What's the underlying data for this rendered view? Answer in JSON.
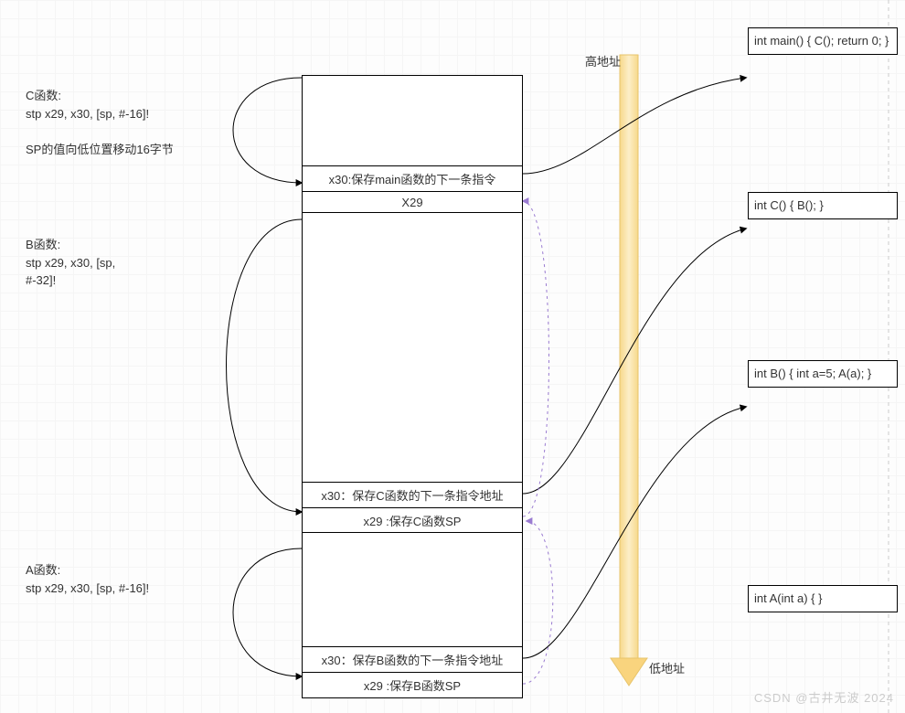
{
  "labels": {
    "highAddr": "高地址",
    "lowAddr": "低地址",
    "c": "C函数:\nstp x29, x30, [sp, #-16]!\n\nSP的值向低位置移动16字节",
    "b": "B函数:\nstp x29, x30, [sp,\n#-32]!",
    "a": "A函数:\nstp x29, x30, [sp, #-16]!"
  },
  "stack": {
    "s1r1": "x30:保存main函数的下一条指令",
    "s1r2": "X29",
    "s2r1": "x30：保存C函数的下一条指令地址",
    "s2r2": "x29 :保存C函数SP",
    "s3r1": "x30：保存B函数的下一条指令地址",
    "s3r2": "x29 :保存B函数SP"
  },
  "code": {
    "main": "int main()\n{\n      C();\n      return 0;\n}",
    "c": "int C()\n{\n      B();\n}",
    "b": "int B()\n{\n      int a=5;\n      A(a);\n}",
    "a": "int A(int a)\n{\n}"
  },
  "watermark": "CSDN @古井无波 2024"
}
